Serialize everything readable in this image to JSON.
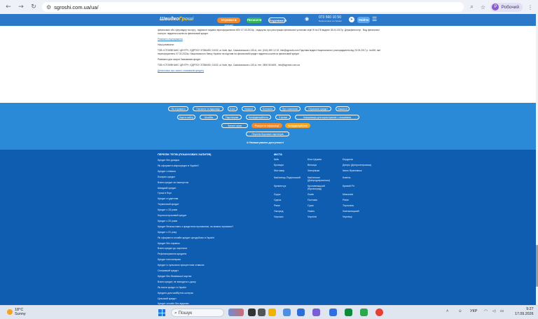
{
  "browser": {
    "url": "sgroshi.com.ua/ua/",
    "profile_label": "Робочий",
    "profile_initial": "Р"
  },
  "header": {
    "logo_a": "Швидко",
    "logo_b": "Гроші",
    "btn_get_loan": "Отримати гроші",
    "btn_repay": "Погасити",
    "btn_extend": "Подовжити",
    "phone": "073 560 10 50",
    "phone_note": "Безкоштовно по Україні",
    "login": "Увійти"
  },
  "content": {
    "p1": "фінансових обо супровідну послугу ,  відомості видача переоформлення НБУ 07.03.2024р , свідоцтво про реєстрацію фінансової установи серії ІК №178 видане 28.04.2017р. Держфінпослуг .  Вид фінансової послуги: надання коштів на фінансовий кредит",
    "link1": "Реквізити ліцензування",
    "p2": "Наші реквізити:",
    "p3": "ТОВ «СТОКФІНАНС ЦЕНТР», ЄДРПОУ 37356450, 01032, м. Київ, вул. Саксаганського 133-А, тел. (044) 490 12 22, info@sgroshi.com  Підстава видачі Національного розпорядження від 20.03.2017 р. №436, яке переоформлено 07.03.2024р. Національного банку України на підставі на фінансовий кредит надання коштів на фінансовий кредит",
    "p4": "Реквізити для скарги Замовників кредит",
    "p5": "ТОВ «СТОКФІНАНС ЦЕНТР», ЄДРПОУ 37356450, 01032, м. Київ, вул. Саксаганського 133-А, тел. 0800 504405 , info@sgroshi.com.ua",
    "link2": "Детальніше про захист споживачів кредиту"
  },
  "footer_links": {
    "row1": [
      "Як отримати",
      "Питання та відповіді",
      "Блог",
      "Новини",
      "Контакти",
      "Про компанію",
      "Отримати кредит",
      "Вакансії"
    ],
    "row2": [
      "Карта сайту",
      "Кешбек",
      "Партнерам",
      "Конфіденційність",
      "Стрічка",
      "Інформація для користувачів і споживачів"
    ],
    "row3": [
      "Захист прав",
      "Розкриття інформації",
      "Конфіденційність"
    ],
    "row4": "Перелік боргових партнерів",
    "accessibility": "Налаштування доступності"
  },
  "footer_seo": {
    "title_left": "ПЕРЕЛІК ТЕГІВ (ПОШУКОВИХ ЗАПИТІВ)",
    "tags": [
      "Кредит без довідок",
      "Як оформити мікрокредит в Україні?",
      "Кредит готівкою",
      "Експрес кредит",
      "Взяти кредит за паспортом",
      "Швидкий кредит",
      "Гроші в борг",
      "Кредит студентам",
      "Терміновий кредит",
      "Кредит з 18 років",
      "Короткостроковий кредит",
      "Кредит з 20 років",
      "Кредит безкоштовно з кредитною проміжною, як можна отримати?",
      "Кредит з 21 року",
      "Як оформити онлайн-кредит цілодобово в Україні",
      "Кредит без справок",
      "Взяти кредит до зарплати",
      "Рефінансування кредитів",
      "Кредит пенсіонерам",
      "Кредит із нульовою процентною ставкою",
      "Споживчий кредит",
      "Кредит без банківської картки",
      "Взяти кредит, не виходячи з дому",
      "Як взяти кредит в Україні",
      "Кредити для майбутніх контрак",
      "Цільовий кредит",
      "Кредит онлайн без відмови"
    ],
    "title_right": "МІСТА",
    "cities": [
      [
        "Київ",
        "Біла Церква",
        "Бердичів"
      ],
      [
        "Бровари",
        "Вінниця",
        "Дніпро (Дніпропетровськ)"
      ],
      [
        "Житомир",
        "Запоріжжя",
        "Івано-Франківськ"
      ],
      [
        "Кам'янець-Подільський",
        "Кам'янське (Дніпродзержинськ)",
        "Ковель"
      ],
      [
        "Кременчук",
        "Кропивницький (Кіровоград)",
        "Кривий Ріг"
      ],
      [
        "Луцьк",
        "Львів",
        "Миколаїв"
      ],
      [
        "Одеса",
        "Полтава",
        "Рівне"
      ],
      [
        "Рівне",
        "Суми",
        "Тернопіль"
      ],
      [
        "Ужгород",
        "Умань",
        "Хмельницький"
      ],
      [
        "Черкаси",
        "Чернігів",
        "Чернівці"
      ]
    ]
  },
  "taskbar": {
    "temp": "18°C",
    "weather": "Sunny",
    "search": "Пошук",
    "lang": "УКР",
    "time": "9:27",
    "date": "17.09.2026"
  }
}
